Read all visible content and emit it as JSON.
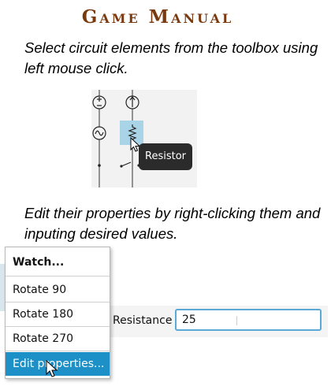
{
  "title": "Game Manual",
  "instructions": {
    "step1": "Select circuit elements from the toolbox using left mouse click.",
    "step2": "Edit their properties by right-clicking them and inputing desired values."
  },
  "toolbox": {
    "tooltip": "Resistor",
    "items": [
      "dc-source-icon",
      "current-source-icon",
      "ac-source-icon",
      "resistor-icon",
      "node-icon",
      "switch-icon"
    ],
    "selected_color": "#a9d3e6"
  },
  "context_menu": {
    "items": [
      {
        "label": "Watch...",
        "bold": true
      },
      {
        "label": "Rotate 90"
      },
      {
        "label": "Rotate 180"
      },
      {
        "label": "Rotate 270"
      },
      {
        "label": "Edit properties...",
        "highlighted": true
      }
    ],
    "highlight_color": "#1e90c8"
  },
  "property": {
    "label": "Resistance",
    "value": "25"
  },
  "colors": {
    "title": "#7a3a10",
    "input_border": "#5aa9d6"
  }
}
